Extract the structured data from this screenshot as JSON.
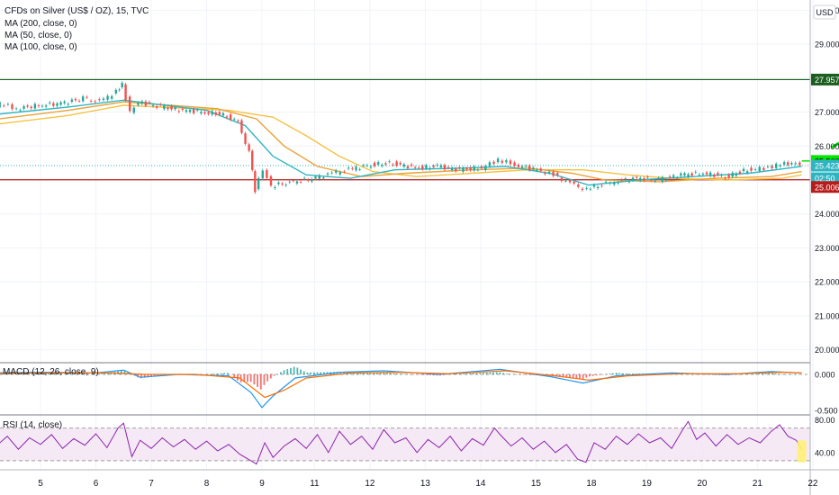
{
  "header": {
    "title": "CFDs on Silver (US$ / OZ), 15, TVC",
    "indicators": [
      "MA (200, close, 0)",
      "MA (50, close, 0)",
      "MA (100, close, 0)"
    ],
    "currency": "USD"
  },
  "colors": {
    "candle_up": "#26a69a",
    "candle_down": "#ef5350",
    "ma50": "#2fb5c2",
    "ma100": "#e8a33a",
    "ma200": "#f5c242",
    "resistance": "#1b5e20",
    "support": "#b71c1c",
    "target": "#00e600",
    "rsi": "#8e24aa",
    "macd_line": "#2196f3",
    "macd_signal": "#ff6d00"
  },
  "chart_data": {
    "type": "line",
    "series_kind": "candlestick price (approximated as close path)",
    "x_ticks": [
      "5",
      "6",
      "7",
      "8",
      "9",
      "11",
      "12",
      "13",
      "14",
      "15",
      "18",
      "19",
      "20",
      "21",
      "22"
    ],
    "y_ticks": [
      "30.000",
      "29.000",
      "28.000",
      "27.000",
      "26.000",
      "25.000",
      "24.000",
      "23.000",
      "22.000",
      "21.000",
      "20.000"
    ],
    "ylim": [
      19.7,
      30.3
    ],
    "price": [
      {
        "x": 4.0,
        "y": 27.0
      },
      {
        "x": 4.3,
        "y": 27.25
      },
      {
        "x": 4.6,
        "y": 27.1
      },
      {
        "x": 5.0,
        "y": 27.2
      },
      {
        "x": 5.4,
        "y": 27.25
      },
      {
        "x": 5.8,
        "y": 27.4
      },
      {
        "x": 6.1,
        "y": 27.3
      },
      {
        "x": 6.4,
        "y": 27.6
      },
      {
        "x": 6.5,
        "y": 27.8
      },
      {
        "x": 6.65,
        "y": 27.0
      },
      {
        "x": 6.8,
        "y": 27.3
      },
      {
        "x": 7.2,
        "y": 27.15
      },
      {
        "x": 7.6,
        "y": 27.05
      },
      {
        "x": 8.0,
        "y": 27.0
      },
      {
        "x": 8.4,
        "y": 26.9
      },
      {
        "x": 8.6,
        "y": 26.7
      },
      {
        "x": 8.8,
        "y": 25.8
      },
      {
        "x": 8.9,
        "y": 24.7
      },
      {
        "x": 9.05,
        "y": 25.3
      },
      {
        "x": 9.2,
        "y": 24.8
      },
      {
        "x": 9.4,
        "y": 24.9
      },
      {
        "x": 9.6,
        "y": 24.95
      },
      {
        "x": 10.0,
        "y": 25.05
      },
      {
        "x": 10.3,
        "y": 25.2
      },
      {
        "x": 10.6,
        "y": 25.3
      },
      {
        "x": 11.0,
        "y": 25.45
      },
      {
        "x": 11.4,
        "y": 25.5
      },
      {
        "x": 11.8,
        "y": 25.35
      },
      {
        "x": 12.2,
        "y": 25.4
      },
      {
        "x": 12.6,
        "y": 25.3
      },
      {
        "x": 13.0,
        "y": 25.35
      },
      {
        "x": 13.3,
        "y": 25.6
      },
      {
        "x": 13.6,
        "y": 25.45
      },
      {
        "x": 14.0,
        "y": 25.3
      },
      {
        "x": 14.3,
        "y": 25.15
      },
      {
        "x": 14.6,
        "y": 24.9
      },
      {
        "x": 14.9,
        "y": 24.7
      },
      {
        "x": 15.1,
        "y": 24.85
      },
      {
        "x": 15.4,
        "y": 24.95
      },
      {
        "x": 15.8,
        "y": 25.05
      },
      {
        "x": 16.2,
        "y": 25.0
      },
      {
        "x": 16.6,
        "y": 25.15
      },
      {
        "x": 17.0,
        "y": 25.2
      },
      {
        "x": 17.4,
        "y": 25.1
      },
      {
        "x": 17.8,
        "y": 25.3
      },
      {
        "x": 18.1,
        "y": 25.35
      },
      {
        "x": 18.4,
        "y": 25.45
      },
      {
        "x": 18.6,
        "y": 25.5
      },
      {
        "x": 18.75,
        "y": 25.42
      }
    ],
    "ma50": [
      {
        "x": 4.0,
        "y": 26.9
      },
      {
        "x": 5.5,
        "y": 27.15
      },
      {
        "x": 6.5,
        "y": 27.35
      },
      {
        "x": 8.0,
        "y": 27.05
      },
      {
        "x": 8.7,
        "y": 26.6
      },
      {
        "x": 9.2,
        "y": 25.7
      },
      {
        "x": 9.8,
        "y": 25.15
      },
      {
        "x": 10.6,
        "y": 25.05
      },
      {
        "x": 11.4,
        "y": 25.3
      },
      {
        "x": 12.6,
        "y": 25.35
      },
      {
        "x": 13.4,
        "y": 25.4
      },
      {
        "x": 14.2,
        "y": 25.2
      },
      {
        "x": 14.9,
        "y": 24.85
      },
      {
        "x": 15.8,
        "y": 25.0
      },
      {
        "x": 16.8,
        "y": 25.1
      },
      {
        "x": 17.8,
        "y": 25.2
      },
      {
        "x": 18.75,
        "y": 25.4
      }
    ],
    "ma100": [
      {
        "x": 4.0,
        "y": 26.75
      },
      {
        "x": 5.5,
        "y": 27.05
      },
      {
        "x": 6.5,
        "y": 27.3
      },
      {
        "x": 8.2,
        "y": 27.1
      },
      {
        "x": 8.9,
        "y": 26.8
      },
      {
        "x": 9.4,
        "y": 26.0
      },
      {
        "x": 10.0,
        "y": 25.4
      },
      {
        "x": 10.8,
        "y": 25.1
      },
      {
        "x": 11.6,
        "y": 25.2
      },
      {
        "x": 12.8,
        "y": 25.3
      },
      {
        "x": 13.8,
        "y": 25.35
      },
      {
        "x": 14.6,
        "y": 25.2
      },
      {
        "x": 15.2,
        "y": 25.0
      },
      {
        "x": 16.2,
        "y": 24.95
      },
      {
        "x": 17.2,
        "y": 25.05
      },
      {
        "x": 18.2,
        "y": 25.1
      },
      {
        "x": 18.75,
        "y": 25.25
      }
    ],
    "ma200": [
      {
        "x": 4.0,
        "y": 26.6
      },
      {
        "x": 5.5,
        "y": 26.9
      },
      {
        "x": 6.5,
        "y": 27.2
      },
      {
        "x": 8.4,
        "y": 27.05
      },
      {
        "x": 9.2,
        "y": 26.85
      },
      {
        "x": 9.8,
        "y": 26.3
      },
      {
        "x": 10.4,
        "y": 25.7
      },
      {
        "x": 11.0,
        "y": 25.25
      },
      {
        "x": 11.8,
        "y": 25.1
      },
      {
        "x": 12.8,
        "y": 25.2
      },
      {
        "x": 13.8,
        "y": 25.3
      },
      {
        "x": 14.8,
        "y": 25.3
      },
      {
        "x": 15.6,
        "y": 25.15
      },
      {
        "x": 16.4,
        "y": 25.05
      },
      {
        "x": 17.4,
        "y": 25.0
      },
      {
        "x": 18.4,
        "y": 25.05
      },
      {
        "x": 18.75,
        "y": 25.15
      }
    ],
    "levels": {
      "resistance": {
        "y": 27.957,
        "label": "27.957"
      },
      "target": {
        "y": 25.56,
        "label": "25.560"
      },
      "current": {
        "y": 25.423,
        "label": "25.423",
        "countdown": "02:50"
      },
      "support": {
        "y": 25.006,
        "label": "25.006"
      }
    },
    "arrow": {
      "x1": 19.3,
      "y1": 25.97,
      "x2": 19.6,
      "y2": 26.25
    },
    "macd": {
      "title": "MACD (12, 26, close, 9)",
      "y_ticks": [
        "0.000",
        "-0.500"
      ],
      "ylim": [
        -0.55,
        0.15
      ],
      "line": [
        {
          "x": 4.0,
          "y": 0.02
        },
        {
          "x": 5.0,
          "y": 0.03
        },
        {
          "x": 6.0,
          "y": 0.02
        },
        {
          "x": 6.5,
          "y": 0.06
        },
        {
          "x": 6.8,
          "y": -0.04
        },
        {
          "x": 7.5,
          "y": 0.0
        },
        {
          "x": 8.4,
          "y": -0.02
        },
        {
          "x": 8.8,
          "y": -0.25
        },
        {
          "x": 9.0,
          "y": -0.46
        },
        {
          "x": 9.2,
          "y": -0.3
        },
        {
          "x": 9.6,
          "y": -0.05
        },
        {
          "x": 10.4,
          "y": 0.03
        },
        {
          "x": 11.2,
          "y": 0.05
        },
        {
          "x": 12.2,
          "y": 0.0
        },
        {
          "x": 13.3,
          "y": 0.07
        },
        {
          "x": 14.2,
          "y": -0.03
        },
        {
          "x": 14.8,
          "y": -0.12
        },
        {
          "x": 15.4,
          "y": -0.02
        },
        {
          "x": 16.4,
          "y": 0.02
        },
        {
          "x": 17.4,
          "y": 0.0
        },
        {
          "x": 18.2,
          "y": 0.04
        },
        {
          "x": 18.75,
          "y": 0.02
        }
      ],
      "signal": [
        {
          "x": 4.0,
          "y": 0.01
        },
        {
          "x": 5.2,
          "y": 0.02
        },
        {
          "x": 6.3,
          "y": 0.02
        },
        {
          "x": 6.9,
          "y": 0.0
        },
        {
          "x": 7.8,
          "y": 0.0
        },
        {
          "x": 8.6,
          "y": -0.05
        },
        {
          "x": 9.05,
          "y": -0.32
        },
        {
          "x": 9.4,
          "y": -0.22
        },
        {
          "x": 9.8,
          "y": -0.05
        },
        {
          "x": 10.6,
          "y": 0.02
        },
        {
          "x": 11.4,
          "y": 0.03
        },
        {
          "x": 12.4,
          "y": 0.01
        },
        {
          "x": 13.4,
          "y": 0.05
        },
        {
          "x": 14.3,
          "y": -0.02
        },
        {
          "x": 14.9,
          "y": -0.08
        },
        {
          "x": 15.6,
          "y": -0.02
        },
        {
          "x": 16.6,
          "y": 0.01
        },
        {
          "x": 17.6,
          "y": 0.01
        },
        {
          "x": 18.4,
          "y": 0.03
        },
        {
          "x": 18.75,
          "y": 0.02
        }
      ]
    },
    "rsi": {
      "title": "RSI (14, close)",
      "y_ticks": [
        "80.00",
        "40.00"
      ],
      "ylim": [
        20,
        85
      ],
      "band": [
        30,
        70
      ],
      "values": [
        {
          "x": 4.0,
          "y": 55
        },
        {
          "x": 4.2,
          "y": 48
        },
        {
          "x": 4.4,
          "y": 60
        },
        {
          "x": 4.6,
          "y": 44
        },
        {
          "x": 4.8,
          "y": 58
        },
        {
          "x": 5.0,
          "y": 50
        },
        {
          "x": 5.2,
          "y": 62
        },
        {
          "x": 5.4,
          "y": 45
        },
        {
          "x": 5.6,
          "y": 57
        },
        {
          "x": 5.8,
          "y": 49
        },
        {
          "x": 6.0,
          "y": 63
        },
        {
          "x": 6.2,
          "y": 46
        },
        {
          "x": 6.4,
          "y": 70
        },
        {
          "x": 6.5,
          "y": 76
        },
        {
          "x": 6.65,
          "y": 35
        },
        {
          "x": 6.8,
          "y": 55
        },
        {
          "x": 7.0,
          "y": 45
        },
        {
          "x": 7.2,
          "y": 58
        },
        {
          "x": 7.4,
          "y": 47
        },
        {
          "x": 7.6,
          "y": 56
        },
        {
          "x": 7.8,
          "y": 44
        },
        {
          "x": 8.0,
          "y": 54
        },
        {
          "x": 8.2,
          "y": 42
        },
        {
          "x": 8.4,
          "y": 50
        },
        {
          "x": 8.6,
          "y": 38
        },
        {
          "x": 8.8,
          "y": 30
        },
        {
          "x": 8.9,
          "y": 26
        },
        {
          "x": 9.05,
          "y": 52
        },
        {
          "x": 9.2,
          "y": 34
        },
        {
          "x": 9.4,
          "y": 48
        },
        {
          "x": 9.6,
          "y": 57
        },
        {
          "x": 9.8,
          "y": 45
        },
        {
          "x": 10.0,
          "y": 62
        },
        {
          "x": 10.2,
          "y": 40
        },
        {
          "x": 10.4,
          "y": 66
        },
        {
          "x": 10.6,
          "y": 50
        },
        {
          "x": 10.8,
          "y": 60
        },
        {
          "x": 11.0,
          "y": 44
        },
        {
          "x": 11.2,
          "y": 68
        },
        {
          "x": 11.4,
          "y": 52
        },
        {
          "x": 11.6,
          "y": 58
        },
        {
          "x": 11.8,
          "y": 40
        },
        {
          "x": 12.0,
          "y": 56
        },
        {
          "x": 12.2,
          "y": 46
        },
        {
          "x": 12.4,
          "y": 60
        },
        {
          "x": 12.6,
          "y": 42
        },
        {
          "x": 12.8,
          "y": 57
        },
        {
          "x": 13.0,
          "y": 49
        },
        {
          "x": 13.2,
          "y": 70
        },
        {
          "x": 13.3,
          "y": 62
        },
        {
          "x": 13.5,
          "y": 48
        },
        {
          "x": 13.7,
          "y": 58
        },
        {
          "x": 13.9,
          "y": 44
        },
        {
          "x": 14.1,
          "y": 54
        },
        {
          "x": 14.3,
          "y": 40
        },
        {
          "x": 14.5,
          "y": 50
        },
        {
          "x": 14.7,
          "y": 32
        },
        {
          "x": 14.85,
          "y": 28
        },
        {
          "x": 15.0,
          "y": 52
        },
        {
          "x": 15.2,
          "y": 44
        },
        {
          "x": 15.4,
          "y": 60
        },
        {
          "x": 15.6,
          "y": 50
        },
        {
          "x": 15.8,
          "y": 63
        },
        {
          "x": 16.0,
          "y": 52
        },
        {
          "x": 16.2,
          "y": 58
        },
        {
          "x": 16.4,
          "y": 45
        },
        {
          "x": 16.6,
          "y": 68
        },
        {
          "x": 16.7,
          "y": 78
        },
        {
          "x": 16.85,
          "y": 56
        },
        {
          "x": 17.0,
          "y": 64
        },
        {
          "x": 17.2,
          "y": 48
        },
        {
          "x": 17.4,
          "y": 62
        },
        {
          "x": 17.6,
          "y": 50
        },
        {
          "x": 17.8,
          "y": 58
        },
        {
          "x": 18.0,
          "y": 52
        },
        {
          "x": 18.2,
          "y": 66
        },
        {
          "x": 18.35,
          "y": 74
        },
        {
          "x": 18.5,
          "y": 60
        },
        {
          "x": 18.65,
          "y": 55
        },
        {
          "x": 18.75,
          "y": 44
        }
      ]
    }
  }
}
